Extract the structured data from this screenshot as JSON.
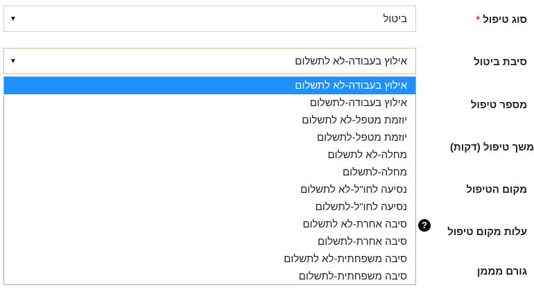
{
  "form": {
    "type_label": "סוג טיפול",
    "required_mark": "*",
    "type_value": "ביטול",
    "reason_label": "סיבת ביטול",
    "reason_value": "אילוץ בעבודה-לא לתשלום",
    "number_label": "מספר טיפול",
    "duration_label": "משך טיפול (דקות)",
    "location_label": "מקום הטיפול",
    "location_cost_label": "עלות מקום טיפול",
    "funder_label": "גורם מממן",
    "help_glyph": "?"
  },
  "dropdown": {
    "options": [
      "אילוץ בעבודה-לא לתשלום",
      "אילוץ בעבודה-לתשלום",
      "יוזמת מטפל-לא לתשלום",
      "יוזמת מטפל-לתשלום",
      "מחלה-לא לתשלום",
      "מחלה-לתשלום",
      "נסיעה לחו\"ל-לא לתשלום",
      "נסיעה לחו\"ל-לתשלום",
      "סיבה אחרת-לא לתשלום",
      "סיבה אחרת-לתשלום",
      "סיבה משפחתית-לא לתשלום",
      "סיבה משפחתית-לתשלום"
    ],
    "selected_index": 0
  },
  "icons": {
    "select_arrow": "caret-down-icon",
    "help": "question-circle-icon"
  },
  "colors": {
    "selected_option_bg": "#1e90ff",
    "required": "#e53935",
    "focus_border": "#f0b27a"
  }
}
